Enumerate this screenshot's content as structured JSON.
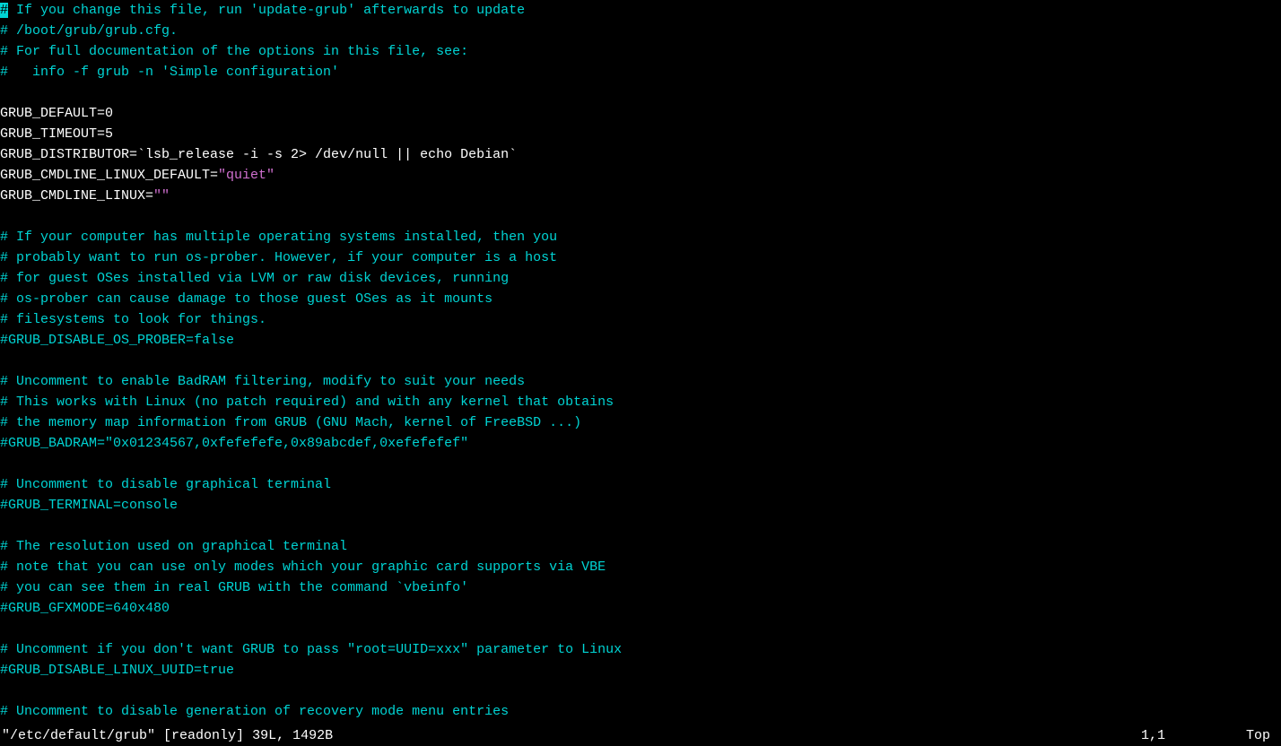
{
  "editor": {
    "lines": [
      {
        "segments": [
          {
            "cls": "cursor",
            "text": "#"
          },
          {
            "cls": "comment",
            "text": " If you change this file, run 'update-grub' afterwards to update"
          }
        ]
      },
      {
        "segments": [
          {
            "cls": "comment",
            "text": "# /boot/grub/grub.cfg."
          }
        ]
      },
      {
        "segments": [
          {
            "cls": "comment",
            "text": "# For full documentation of the options in this file, see:"
          }
        ]
      },
      {
        "segments": [
          {
            "cls": "comment",
            "text": "#   info -f grub -n 'Simple configuration'"
          }
        ]
      },
      {
        "segments": [
          {
            "cls": "text",
            "text": ""
          }
        ]
      },
      {
        "segments": [
          {
            "cls": "text",
            "text": "GRUB_DEFAULT=0"
          }
        ]
      },
      {
        "segments": [
          {
            "cls": "text",
            "text": "GRUB_TIMEOUT=5"
          }
        ]
      },
      {
        "segments": [
          {
            "cls": "text",
            "text": "GRUB_DISTRIBUTOR=`lsb_release -i -s 2> /dev/null || echo Debian`"
          }
        ]
      },
      {
        "segments": [
          {
            "cls": "text",
            "text": "GRUB_CMDLINE_LINUX_DEFAULT="
          },
          {
            "cls": "string",
            "text": "\"quiet\""
          }
        ]
      },
      {
        "segments": [
          {
            "cls": "text",
            "text": "GRUB_CMDLINE_LINUX="
          },
          {
            "cls": "string",
            "text": "\"\""
          }
        ]
      },
      {
        "segments": [
          {
            "cls": "text",
            "text": ""
          }
        ]
      },
      {
        "segments": [
          {
            "cls": "comment",
            "text": "# If your computer has multiple operating systems installed, then you"
          }
        ]
      },
      {
        "segments": [
          {
            "cls": "comment",
            "text": "# probably want to run os-prober. However, if your computer is a host"
          }
        ]
      },
      {
        "segments": [
          {
            "cls": "comment",
            "text": "# for guest OSes installed via LVM or raw disk devices, running"
          }
        ]
      },
      {
        "segments": [
          {
            "cls": "comment",
            "text": "# os-prober can cause damage to those guest OSes as it mounts"
          }
        ]
      },
      {
        "segments": [
          {
            "cls": "comment",
            "text": "# filesystems to look for things."
          }
        ]
      },
      {
        "segments": [
          {
            "cls": "comment",
            "text": "#GRUB_DISABLE_OS_PROBER=false"
          }
        ]
      },
      {
        "segments": [
          {
            "cls": "text",
            "text": ""
          }
        ]
      },
      {
        "segments": [
          {
            "cls": "comment",
            "text": "# Uncomment to enable BadRAM filtering, modify to suit your needs"
          }
        ]
      },
      {
        "segments": [
          {
            "cls": "comment",
            "text": "# This works with Linux (no patch required) and with any kernel that obtains"
          }
        ]
      },
      {
        "segments": [
          {
            "cls": "comment",
            "text": "# the memory map information from GRUB (GNU Mach, kernel of FreeBSD ...)"
          }
        ]
      },
      {
        "segments": [
          {
            "cls": "comment",
            "text": "#GRUB_BADRAM=\"0x01234567,0xfefefefe,0x89abcdef,0xefefefef\""
          }
        ]
      },
      {
        "segments": [
          {
            "cls": "text",
            "text": ""
          }
        ]
      },
      {
        "segments": [
          {
            "cls": "comment",
            "text": "# Uncomment to disable graphical terminal"
          }
        ]
      },
      {
        "segments": [
          {
            "cls": "comment",
            "text": "#GRUB_TERMINAL=console"
          }
        ]
      },
      {
        "segments": [
          {
            "cls": "text",
            "text": ""
          }
        ]
      },
      {
        "segments": [
          {
            "cls": "comment",
            "text": "# The resolution used on graphical terminal"
          }
        ]
      },
      {
        "segments": [
          {
            "cls": "comment",
            "text": "# note that you can use only modes which your graphic card supports via VBE"
          }
        ]
      },
      {
        "segments": [
          {
            "cls": "comment",
            "text": "# you can see them in real GRUB with the command `vbeinfo'"
          }
        ]
      },
      {
        "segments": [
          {
            "cls": "comment",
            "text": "#GRUB_GFXMODE=640x480"
          }
        ]
      },
      {
        "segments": [
          {
            "cls": "text",
            "text": ""
          }
        ]
      },
      {
        "segments": [
          {
            "cls": "comment",
            "text": "# Uncomment if you don't want GRUB to pass \"root=UUID=xxx\" parameter to Linux"
          }
        ]
      },
      {
        "segments": [
          {
            "cls": "comment",
            "text": "#GRUB_DISABLE_LINUX_UUID=true"
          }
        ]
      },
      {
        "segments": [
          {
            "cls": "text",
            "text": ""
          }
        ]
      },
      {
        "segments": [
          {
            "cls": "comment",
            "text": "# Uncomment to disable generation of recovery mode menu entries"
          }
        ]
      }
    ]
  },
  "status": {
    "filename": "\"/etc/default/grub\"",
    "readonly": "[readonly]",
    "file_stats": "39L, 1492B",
    "cursor_position": "1,1",
    "scroll_position": "Top"
  }
}
